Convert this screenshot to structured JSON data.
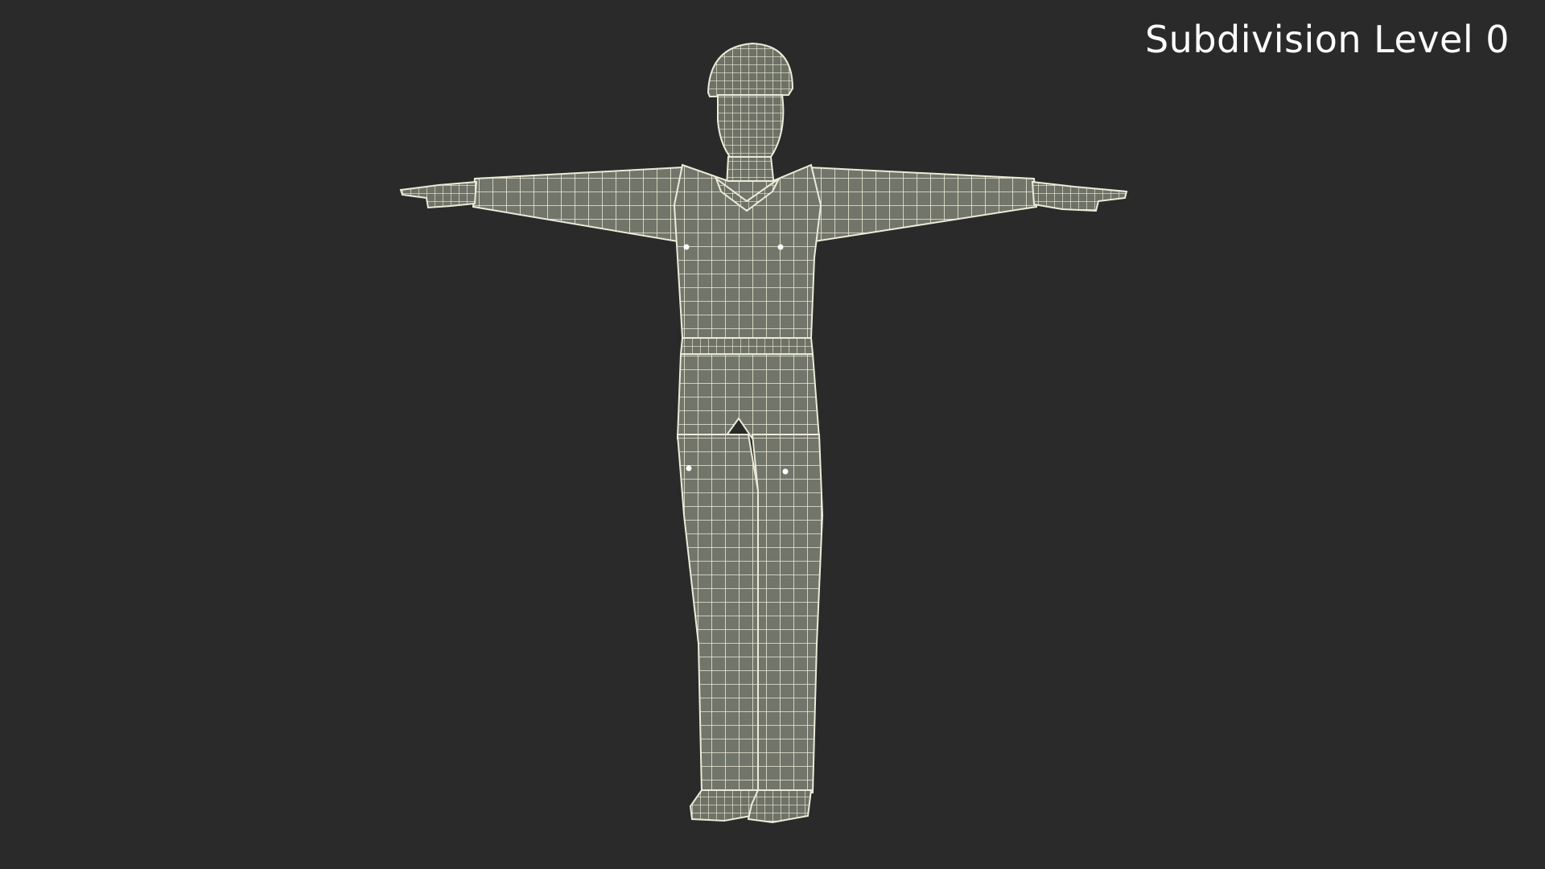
{
  "overlay": {
    "subdivision_label": "Subdivision Level 0"
  },
  "scene": {
    "background_color": "#2a2a2a",
    "mesh_fill_color": "#72756a",
    "wire_color": "#ecebd9",
    "subject": "construction worker in hard hat and coveralls, T-pose wireframe"
  }
}
